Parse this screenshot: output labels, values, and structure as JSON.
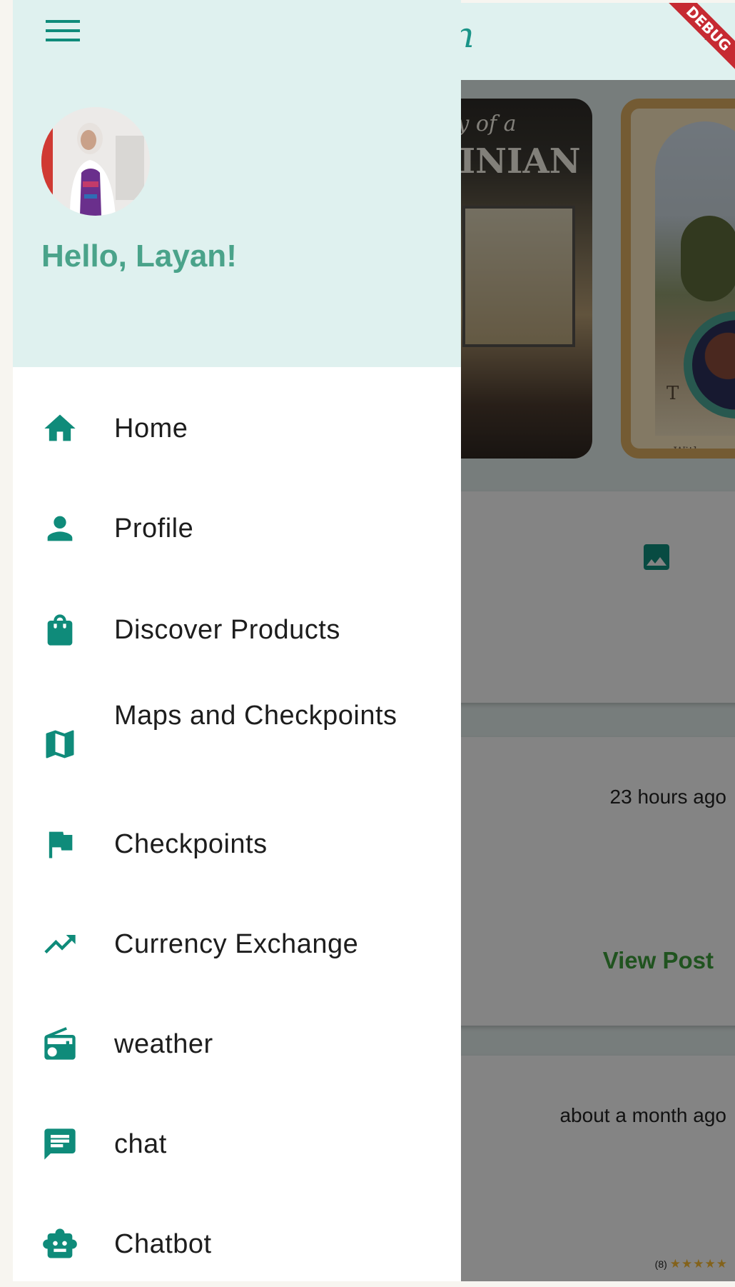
{
  "app": {
    "logo_text": "watan",
    "debug_banner": "DEBUG"
  },
  "background": {
    "carousel": {
      "card1_title": "TINIAN",
      "card1_subtitle": "ory of a",
      "card2_text": "T",
      "card2_small": "With a"
    },
    "feed": [
      {
        "icon": "image-icon"
      },
      {
        "time": "23 hours ago",
        "action": "View Post"
      },
      {
        "time": "about a month ago",
        "rating_count": "(8)",
        "stars": "★★★★★"
      }
    ]
  },
  "drawer": {
    "greeting": "Hello, Layan!",
    "items": [
      {
        "icon": "home-icon",
        "label": "Home"
      },
      {
        "icon": "person-icon",
        "label": "Profile"
      },
      {
        "icon": "shopping-bag-icon",
        "label": "Discover Products"
      },
      {
        "icon": "map-icon",
        "label": "Maps and Checkpoints"
      },
      {
        "icon": "flag-icon",
        "label": "Checkpoints"
      },
      {
        "icon": "trending-up-icon",
        "label": "Currency Exchange"
      },
      {
        "icon": "radio-icon",
        "label": "weather"
      },
      {
        "icon": "chat-icon",
        "label": "chat"
      },
      {
        "icon": "robot-icon",
        "label": "Chatbot"
      }
    ]
  },
  "colors": {
    "accent": "#0f8b7a",
    "header_bg": "#dff1ef",
    "greeting": "#4aa38a",
    "view_post": "#3c9a3a"
  }
}
